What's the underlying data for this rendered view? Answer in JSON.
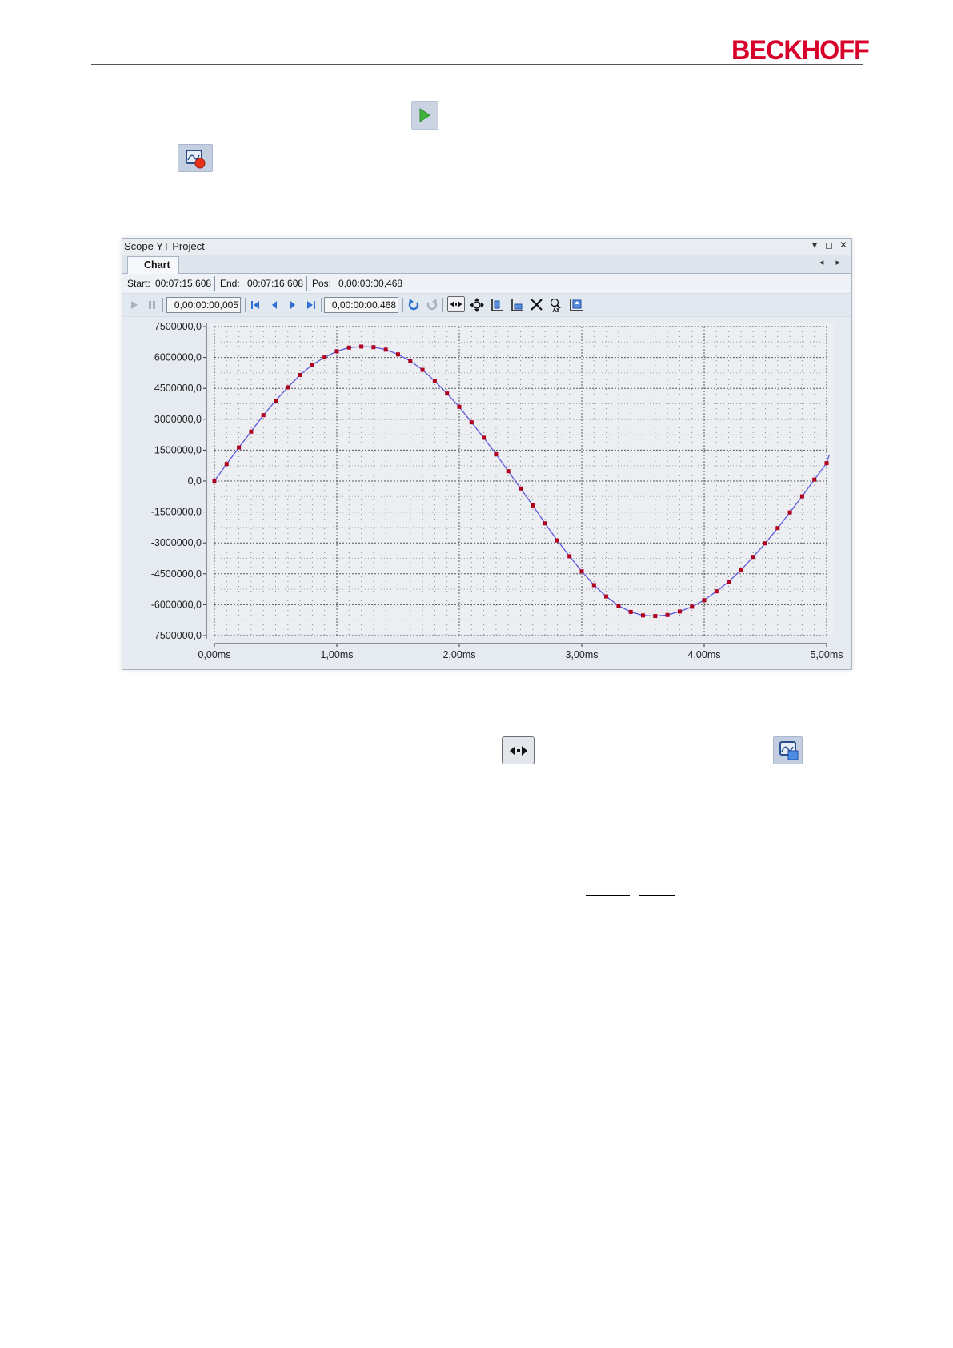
{
  "header": {
    "logo_text": "BECKHOFF"
  },
  "inline_icons": {
    "start_record": "play-icon",
    "stop_record": "record-stop-icon",
    "pan_mode": "pan-x-icon",
    "chart_window": "chart-window-icon"
  },
  "scope_window": {
    "title": "Scope YT Project",
    "window_buttons": {
      "menu": "▾",
      "maximize": "◻",
      "close": "✕"
    },
    "tab": "Chart",
    "tab_nav": "◂ ▸",
    "info": {
      "start_label": "Start:",
      "start_value": "00:07:15,608",
      "end_label": "End:",
      "end_value": "00:07:16,608",
      "pos_label": "Pos:",
      "pos_value": "0,00:00:00,468"
    },
    "toolbar": {
      "step_value": "0,00:00:00,005",
      "position_value": "0,00:00:00.468"
    }
  },
  "colors": {
    "brand": "#d8002b",
    "curve": "#5a5ae0",
    "marker": "#b00020",
    "plot_bg": "#eceef1"
  },
  "chart_data": {
    "type": "line",
    "title": "",
    "xlabel": "",
    "ylabel": "",
    "xlim": [
      0,
      5
    ],
    "ylim": [
      -7500000,
      7500000
    ],
    "x_ticks": [
      0,
      1,
      2,
      3,
      4,
      5
    ],
    "x_tick_labels": [
      "0,00ms",
      "1,00ms",
      "2,00ms",
      "3,00ms",
      "4,00ms",
      "5,00ms"
    ],
    "y_ticks": [
      7500000,
      6000000,
      4500000,
      3000000,
      1500000,
      0,
      -1500000,
      -3000000,
      -4500000,
      -6000000,
      -7500000
    ],
    "y_tick_labels": [
      "7500000,0",
      "6000000,0",
      "4500000,0",
      "3000000,0",
      "1500000,0",
      "0,0",
      "-1500000,0",
      "-3000000,0",
      "-4500000,0",
      "-6000000,0",
      "-7500000,0"
    ],
    "grid": true,
    "series": [
      {
        "x": [
          0,
          0.1,
          0.2,
          0.3,
          0.4,
          0.5,
          0.6,
          0.7,
          0.8,
          0.9,
          1.0,
          1.1,
          1.2,
          1.3,
          1.4,
          1.5,
          1.6,
          1.7,
          1.8,
          1.9,
          2.0,
          2.1,
          2.2,
          2.3,
          2.4,
          2.5,
          2.6,
          2.7,
          2.8,
          2.9,
          3.0,
          3.1,
          3.2,
          3.3,
          3.4,
          3.5,
          3.6,
          3.7,
          3.8,
          3.9,
          4.0,
          4.1,
          4.2,
          4.3,
          4.4,
          4.5,
          4.6,
          4.7,
          4.8,
          4.9,
          5.0
        ],
        "values": [
          0,
          830000,
          1630000,
          2400000,
          3200000,
          3900000,
          4550000,
          5150000,
          5650000,
          6000000,
          6300000,
          6480000,
          6530000,
          6500000,
          6380000,
          6150000,
          5830000,
          5400000,
          4850000,
          4250000,
          3600000,
          2850000,
          2100000,
          1300000,
          480000,
          -360000,
          -1180000,
          -2050000,
          -2880000,
          -3650000,
          -4380000,
          -5050000,
          -5600000,
          -6050000,
          -6350000,
          -6520000,
          -6550000,
          -6500000,
          -6330000,
          -6100000,
          -5780000,
          -5350000,
          -4880000,
          -4320000,
          -3680000,
          -3020000,
          -2280000,
          -1520000,
          -740000,
          70000,
          870000
        ],
        "line_end": [
          5.02,
          1250000
        ]
      }
    ]
  }
}
